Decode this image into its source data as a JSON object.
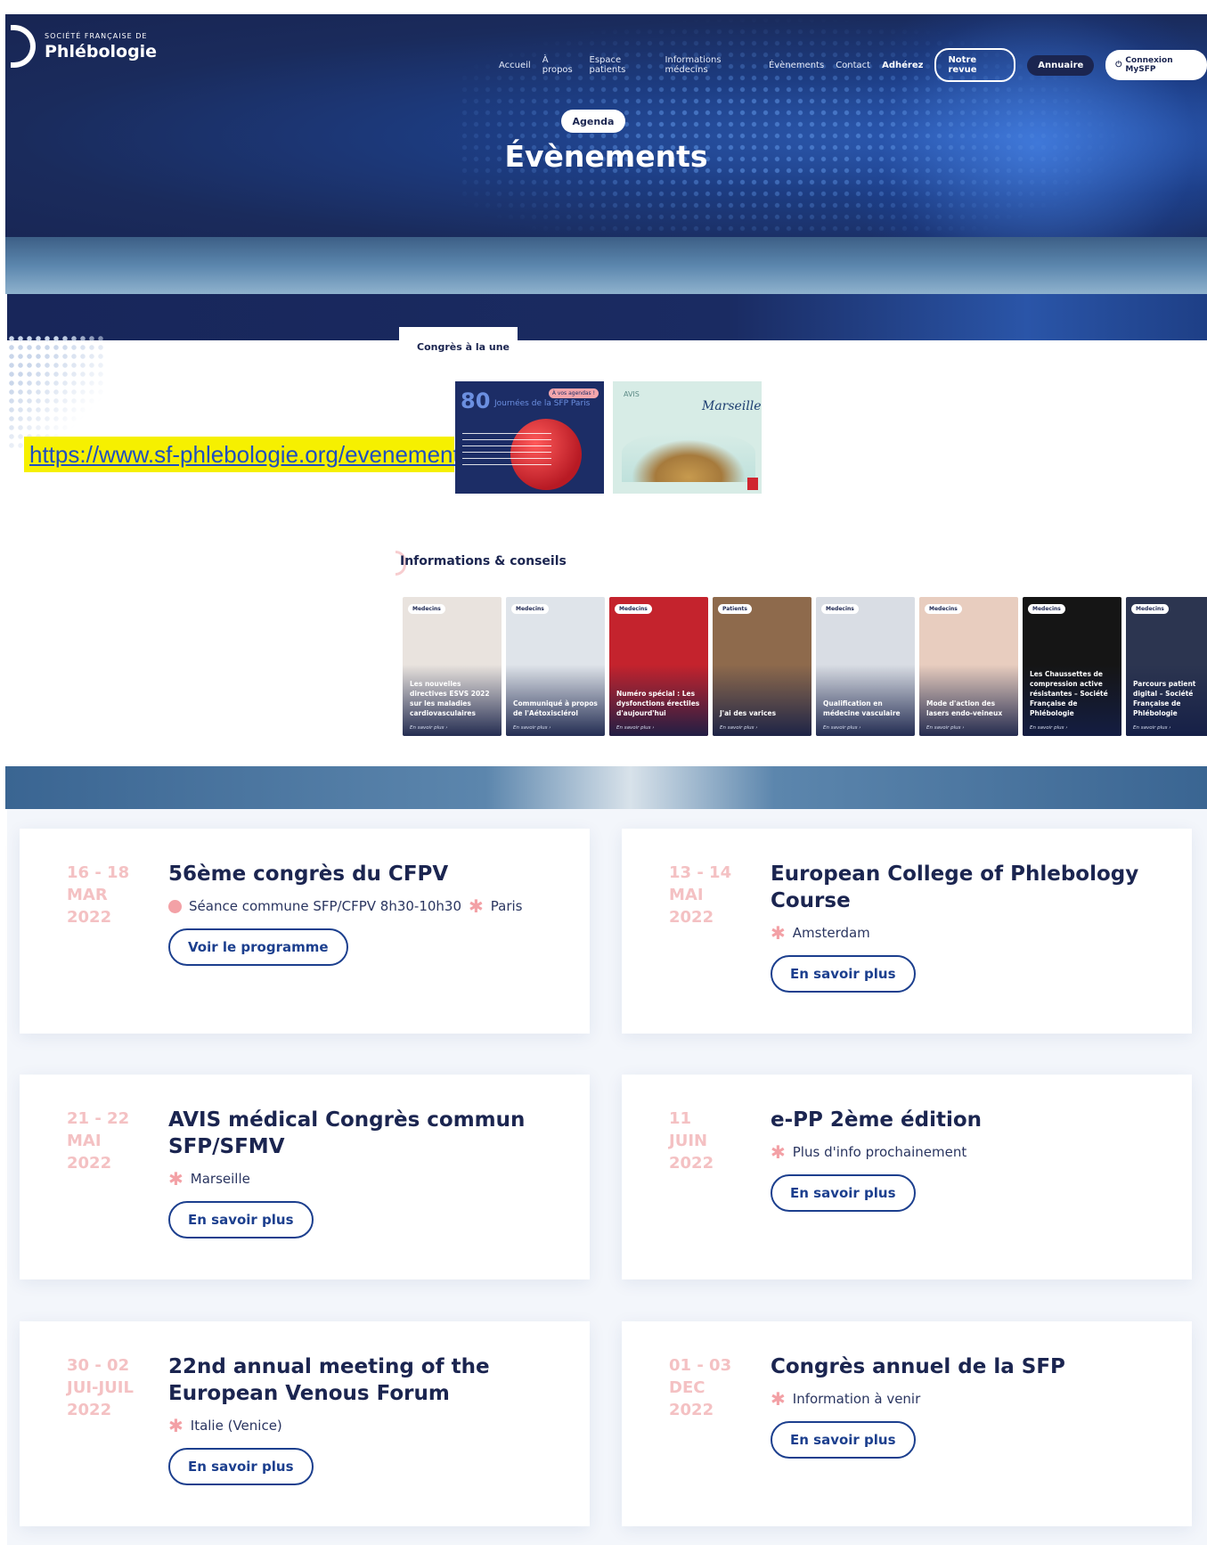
{
  "header": {
    "logo": {
      "small": "SOCIÉTÉ FRANÇAISE DE",
      "name": "Phlébologie"
    },
    "nav": [
      "Accueil",
      "À propos",
      "Espace patients",
      "Informations médecins",
      "Évènements",
      "Contact"
    ],
    "nav_bold": "Adhérez",
    "btn_revue": "Notre revue",
    "btn_annuaire": "Annuaire",
    "btn_connexion": "Connexion MySFP",
    "pill": "Agenda",
    "title": "Évènements"
  },
  "home": {
    "congres_tab": "Congrès à la une",
    "url": "https://www.sf-phlebologie.org/evenements/",
    "poster1": {
      "num": "80",
      "sub": "Journées de la SFP Paris",
      "tag": "À vos agendas !"
    },
    "poster2": {
      "script": "Marseille"
    },
    "info_title": "Informations & conseils",
    "cards": [
      {
        "badge": "Medecins",
        "text": "Les nouvelles directives ESVS 2022 sur les maladies cardiovasculaires",
        "more": "En savoir plus ›",
        "bg": "#e9e3de"
      },
      {
        "badge": "Medecins",
        "text": "Communiqué à propos de l'Aétoxisclérol",
        "more": "En savoir plus ›",
        "bg": "#dfe4ea"
      },
      {
        "badge": "Medecins",
        "text": "Numéro spécial : Les dysfonctions érectiles d'aujourd'hui",
        "more": "En savoir plus ›",
        "bg": "#c4232d"
      },
      {
        "badge": "Patients",
        "text": "J'ai des varices",
        "more": "En savoir plus ›",
        "bg": "#8e6a4c"
      },
      {
        "badge": "Medecins",
        "text": "Qualification en médecine vasculaire",
        "more": "En savoir plus ›",
        "bg": "#d9dde4"
      },
      {
        "badge": "Medecins",
        "text": "Mode d'action des lasers endo-veineux",
        "more": "En savoir plus ›",
        "bg": "#e8cdbf"
      },
      {
        "badge": "Medecins",
        "text": "Les Chaussettes de compression active résistantes – Société Française de Phlébologie",
        "more": "En savoir plus ›",
        "bg": "#151515"
      },
      {
        "badge": "Medecins",
        "text": "Parcours patient digital – Société Française de Phlébologie",
        "more": "En savoir plus ›",
        "bg": "#2c3550"
      }
    ]
  },
  "events": [
    {
      "date": [
        "16 - 18",
        "MAR",
        "2022"
      ],
      "title": "56ème congrès du CFPV",
      "meta": [
        {
          "icon": "clock-icon",
          "text": "Séance commune SFP/CFPV 8h30-10h30"
        },
        {
          "icon": "location-star-icon",
          "text": "Paris"
        }
      ],
      "button": "Voir le programme"
    },
    {
      "date": [
        "13 - 14",
        "MAI",
        "2022"
      ],
      "title": "European College of Phlebology Course",
      "meta": [
        {
          "icon": "location-star-icon",
          "text": "Amsterdam"
        }
      ],
      "button": "En savoir plus"
    },
    {
      "date": [
        "21 - 22",
        "MAI",
        "2022"
      ],
      "title": "AVIS médical Congrès commun SFP/SFMV",
      "meta": [
        {
          "icon": "location-star-icon",
          "text": "Marseille"
        }
      ],
      "button": "En savoir plus"
    },
    {
      "date": [
        "11",
        "JUIN",
        "2022"
      ],
      "title": "e-PP 2ème édition",
      "meta": [
        {
          "icon": "location-star-icon",
          "text": "Plus d'info prochainement"
        }
      ],
      "button": "En savoir plus"
    },
    {
      "date": [
        "30 - 02",
        "JUI-JUIL",
        "2022"
      ],
      "title": "22nd annual meeting of the European Venous Forum",
      "meta": [
        {
          "icon": "location-star-icon",
          "text": "Italie (Venice)"
        }
      ],
      "button": "En savoir plus"
    },
    {
      "date": [
        "01 - 03",
        "DEC",
        "2022"
      ],
      "title": "Congrès annuel de la SFP",
      "meta": [
        {
          "icon": "location-star-icon",
          "text": "Information à venir"
        }
      ],
      "button": "En savoir plus"
    }
  ]
}
